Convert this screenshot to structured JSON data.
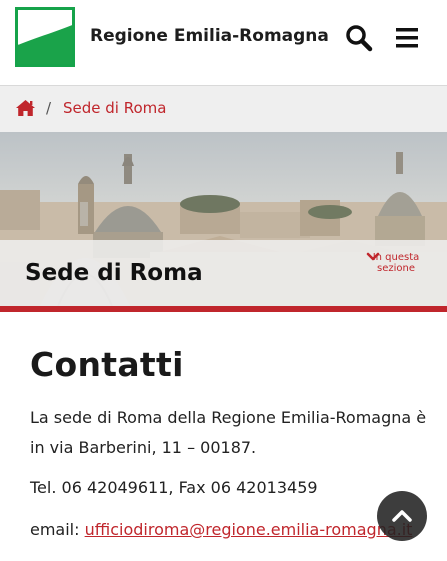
{
  "header": {
    "site_title": "Regione Emilia-Romagna",
    "logo_icon": "regione-emilia-romagna-logo",
    "search_icon": "search-icon",
    "menu_icon": "hamburger-menu-icon"
  },
  "breadcrumb": {
    "home_icon": "home-icon",
    "separator": "/",
    "current": "Sede di Roma"
  },
  "hero": {
    "title": "Sede di Roma",
    "in_section_line1": "In questa",
    "in_section_line2": "sezione",
    "chevron_icon": "chevron-down-icon"
  },
  "content": {
    "heading": "Contatti",
    "address_text": "La sede di Roma della Regione Emilia-Romagna è in via Barberini, 11 – 00187.",
    "phone_text": "Tel. 06 42049611, Fax 06 42013459",
    "email_label": "email: ",
    "email_link": "ufficiodiroma@regione.emilia-romagna.it"
  },
  "back_to_top": {
    "icon": "chevron-up-icon"
  },
  "colors": {
    "accent_red": "#c0262c",
    "logo_green": "#16a34a",
    "breadcrumb_bg": "#efefef"
  }
}
